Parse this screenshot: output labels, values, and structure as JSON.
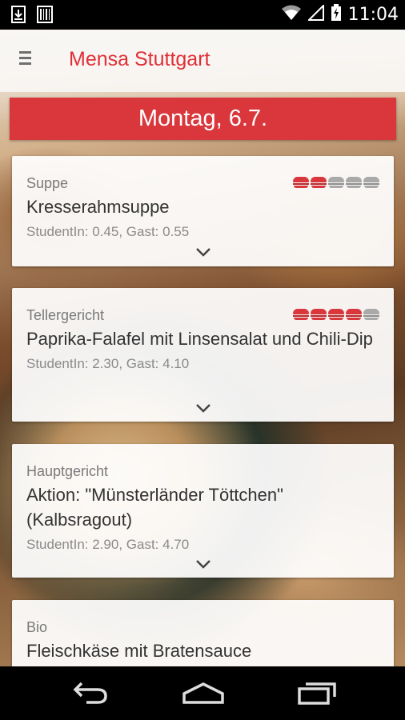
{
  "status_bar": {
    "time": "11:04",
    "icons": [
      "download-icon",
      "barcode-icon",
      "wifi-icon",
      "signal-icon",
      "battery-charging-icon"
    ]
  },
  "app_bar": {
    "title": "Mensa Stuttgart",
    "menu_icon": "hamburger-menu-icon"
  },
  "day": {
    "label": "Montag, 6.7."
  },
  "meals": [
    {
      "category": "Suppe",
      "name": "Kresserahmsuppe",
      "price": "StudentIn: 0.45, Gast: 0.55",
      "rating": 2,
      "rating_max": 5
    },
    {
      "category": "Tellergericht",
      "name": "Paprika-Falafel mit Linsensalat und Chili-Dip",
      "price": "StudentIn: 2.30, Gast: 4.10",
      "rating": 4,
      "rating_max": 5
    },
    {
      "category": "Hauptgericht",
      "name": "Aktion: \"Münsterländer Töttchen\" (Kalbsragout)",
      "price": "StudentIn: 2.90, Gast: 4.70",
      "rating": null,
      "rating_max": 5
    },
    {
      "category": "Bio",
      "name": "Fleischkäse mit Bratensauce",
      "price": "",
      "rating": null,
      "rating_max": 5
    }
  ],
  "nav_bar": {
    "icons": [
      "back-icon",
      "home-icon",
      "recent-apps-icon"
    ]
  },
  "colors": {
    "accent": "#e02f37",
    "banner": "#d9373c",
    "rating_off": "#a9a9a9"
  }
}
